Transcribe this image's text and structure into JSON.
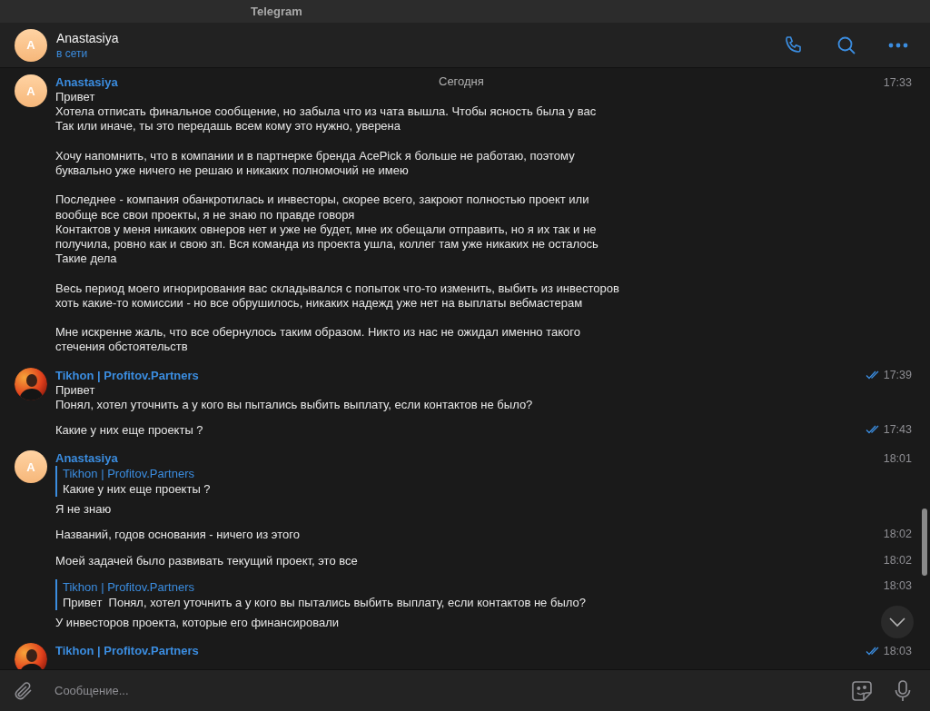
{
  "window": {
    "title": "Telegram"
  },
  "header": {
    "avatar_letter": "A",
    "name": "Anastasiya",
    "status": "в сети"
  },
  "groups": [
    {
      "sender": "Anastasiya",
      "avatar": {
        "kind": "letter",
        "letter": "A"
      },
      "date_label": "Сегодня",
      "messages": [
        {
          "text": "Привет\nХотела отписать финальное сообщение, но забыла что из чата вышла. Чтобы ясность была у вас\nТак или иначе, ты это передашь всем кому это нужно, уверена\n\nХочу напомнить, что в компании и в партнерке бренда AcePick я больше не работаю, поэтому\nбуквально уже ничего не решаю и никаких полномочий не имею\n\nПоследнее - компания обанкротилась и инвесторы, скорее всего, закроют полностью проект или\nвообще все свои проекты, я не знаю по правде говоря\nКонтактов у меня никаких овнеров нет и уже не будет, мне их обещали отправить, но я их так и не\nполучила, ровно как и свою зп. Вся команда из проекта ушла, коллег там уже никаких не осталось\nТакие дела\n\nВесь период моего игнорирования вас складывался с попыток что-то изменить, выбить из инвесторов\nхоть какие-то комиссии - но все обрушилось, никаких надежд уже нет на выплаты вебмастерам\n\nМне искренне жаль, что все обернулось таким образом. Никто из нас не ожидал именно такого\nстечения обстоятельств",
          "time": "17:33"
        }
      ]
    },
    {
      "sender": "Tikhon | Profitov.Partners",
      "avatar": {
        "kind": "picture"
      },
      "messages": [
        {
          "text": "Привет\nПонял, хотел уточнить а у кого вы пытались выбить выплату, если контактов не было?",
          "time": "17:39",
          "read": true
        },
        {
          "text": "Какие у них еще проекты ?",
          "time": "17:43",
          "read": true
        }
      ]
    },
    {
      "sender": "Anastasiya",
      "avatar": {
        "kind": "letter",
        "letter": "A"
      },
      "messages": [
        {
          "reply": {
            "sender": "Tikhon | Profitov.Partners",
            "text": "Какие у них еще проекты ?"
          },
          "text": "Я не знаю",
          "time": "18:01"
        },
        {
          "text": "Названий, годов основания - ничего из этого",
          "time": "18:02"
        },
        {
          "text": "Моей задачей было развивать текущий проект, это все",
          "time": "18:02"
        },
        {
          "reply": {
            "sender": "Tikhon | Profitov.Partners",
            "text": "Привет  Понял, хотел уточнить а у кого вы пытались выбить выплату, если контактов не было?"
          },
          "text": "У инвесторов проекта, которые его финансировали",
          "time": "18:03"
        }
      ]
    },
    {
      "sender": "Tikhon | Profitov.Partners",
      "avatar": {
        "kind": "picture"
      },
      "messages": [
        {
          "time": "18:03",
          "read": true
        }
      ]
    }
  ],
  "composer": {
    "placeholder": "Сообщение..."
  }
}
